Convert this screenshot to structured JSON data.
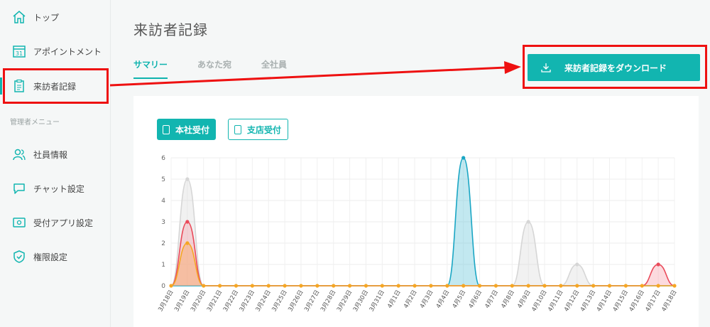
{
  "sidebar": {
    "items": [
      {
        "label": "トップ",
        "icon": "home-icon"
      },
      {
        "label": "アポイントメント",
        "icon": "calendar-icon",
        "calendar_day": "31"
      },
      {
        "label": "来訪者記録",
        "icon": "clipboard-icon"
      },
      {
        "label": "社員情報",
        "icon": "users-icon"
      },
      {
        "label": "チャット設定",
        "icon": "chat-icon"
      },
      {
        "label": "受付アプリ設定",
        "icon": "tablet-icon"
      },
      {
        "label": "権限設定",
        "icon": "shield-icon"
      }
    ],
    "section_label": "管理者メニュー",
    "active_index": 2
  },
  "page": {
    "title": "来訪者記録",
    "tabs": [
      "サマリー",
      "あなた宛",
      "全社員"
    ],
    "active_tab": 0,
    "download_label": "来訪者記録をダウンロード"
  },
  "filters": {
    "headquarters": "本社受付",
    "branch": "支店受付"
  },
  "colors": {
    "accent": "#12b5b0",
    "annotation": "#ee1111"
  },
  "chart_data": {
    "type": "area",
    "x": [
      "3月18日",
      "3月19日",
      "3月20日",
      "3月21日",
      "3月22日",
      "3月23日",
      "3月24日",
      "3月25日",
      "3月26日",
      "3月27日",
      "3月28日",
      "3月29日",
      "3月30日",
      "3月31日",
      "4月1日",
      "4月2日",
      "4月3日",
      "4月4日",
      "4月5日",
      "4月6日",
      "4月7日",
      "4月8日",
      "4月9日",
      "4月10日",
      "4月11日",
      "4月12日",
      "4月13日",
      "4月14日",
      "4月15日",
      "4月16日",
      "4月17日",
      "4月18日"
    ],
    "ylim": [
      0,
      6
    ],
    "yticks": [
      0,
      1,
      2,
      3,
      4,
      5,
      6
    ],
    "grid": true,
    "series": [
      {
        "color": "#d6d6d6",
        "fill": "rgba(215,215,215,0.35)",
        "values": [
          0,
          5,
          0,
          0,
          0,
          0,
          0,
          0,
          0,
          0,
          0,
          0,
          0,
          0,
          0,
          0,
          0,
          0,
          0,
          0,
          0,
          0,
          3,
          0,
          0,
          1,
          0,
          0,
          0,
          0,
          0,
          0
        ]
      },
      {
        "color": "#1aa6c4",
        "fill": "rgba(120,205,222,0.45)",
        "values": [
          0,
          0,
          0,
          0,
          0,
          0,
          0,
          0,
          0,
          0,
          0,
          0,
          0,
          0,
          0,
          0,
          0,
          0,
          6,
          0,
          0,
          0,
          0,
          0,
          0,
          0,
          0,
          0,
          0,
          0,
          0,
          0
        ]
      },
      {
        "color": "#ea4a5a",
        "fill": "rgba(245,150,160,0.35)",
        "values": [
          0,
          3,
          0,
          0,
          0,
          0,
          0,
          0,
          0,
          0,
          0,
          0,
          0,
          0,
          0,
          0,
          0,
          0,
          0,
          0,
          0,
          0,
          0,
          0,
          0,
          0,
          0,
          0,
          0,
          0,
          1,
          0
        ]
      },
      {
        "color": "#f5a623",
        "fill": "rgba(248,175,120,0.55)",
        "values": [
          0,
          2,
          0,
          0,
          0,
          0,
          0,
          0,
          0,
          0,
          0,
          0,
          0,
          0,
          0,
          0,
          0,
          0,
          0,
          0,
          0,
          0,
          0,
          0,
          0,
          0,
          0,
          0,
          0,
          0,
          0,
          0
        ]
      }
    ]
  }
}
